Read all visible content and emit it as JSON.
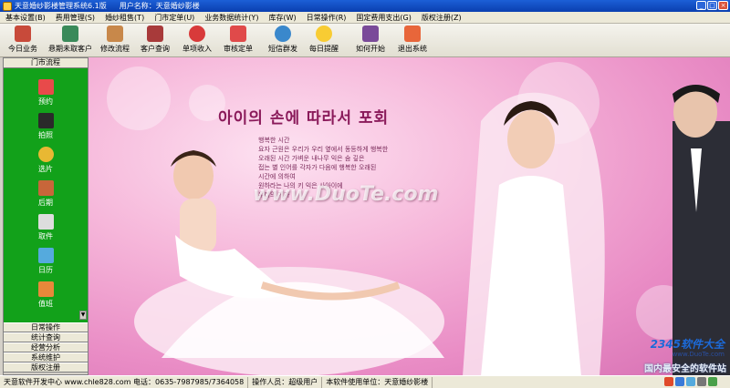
{
  "window": {
    "title": "天意婚纱影楼管理系统6.1版",
    "user_label": "用户名称：天意婚纱影楼",
    "minimize": "_",
    "maximize": "□",
    "close": "×"
  },
  "menu": [
    "基本设置(B)",
    "费用管理(S)",
    "婚纱租售(T)",
    "门市定单(U)",
    "业务数据统计(Y)",
    "库存(W)",
    "日常操作(R)",
    "固定费用支出(G)",
    "版权注册(Z)"
  ],
  "toolbar": [
    {
      "label": "今日业务",
      "icon": "house-icon",
      "color": "#c44"
    },
    {
      "label": "悬期未取客户",
      "icon": "person-icon",
      "color": "#3a6"
    },
    {
      "label": "修改流程",
      "icon": "edit-icon",
      "color": "#c84"
    },
    {
      "label": "客户查询",
      "icon": "bottles-icon",
      "color": "#a33"
    },
    {
      "label": "单项收入",
      "icon": "money-icon",
      "color": "#d33"
    },
    {
      "label": "审核定单",
      "icon": "check-icon",
      "color": "#d44"
    },
    {
      "label": "短信群发",
      "icon": "globe-icon",
      "color": "#38c"
    },
    {
      "label": "每日提醒",
      "icon": "bulb-icon",
      "color": "#fc3"
    },
    {
      "label": "如何开始",
      "icon": "book-icon",
      "color": "#749"
    },
    {
      "label": "退出系统",
      "icon": "exit-icon",
      "color": "#e63"
    }
  ],
  "sidebar": {
    "header": "门市流程",
    "items": [
      {
        "label": "预约",
        "icon": "calendar-icon",
        "color": "#e44"
      },
      {
        "label": "拍照",
        "icon": "camera-icon",
        "color": "#222"
      },
      {
        "label": "选片",
        "icon": "film-icon",
        "color": "#eb3"
      },
      {
        "label": "后期",
        "icon": "palette-icon",
        "color": "#c63"
      },
      {
        "label": "取件",
        "icon": "package-icon",
        "color": "#ddd"
      },
      {
        "label": "日历",
        "icon": "notebook-icon",
        "color": "#5ad"
      },
      {
        "label": "值班",
        "icon": "duty-icon",
        "color": "#e83"
      }
    ],
    "categories": [
      "日常操作",
      "统计查询",
      "经营分析",
      "系统维护",
      "版权注册"
    ]
  },
  "banner": {
    "korean_title": "아이의 손에 따라서 포회",
    "poem": [
      "행복한 시간",
      "요자 근원은 우리가 우리 옆에서 동등하게 행복한",
      "오래된 시간 가벼운 내나무 익은 숨 깊은",
      "접는 별 인어를 각자가 다음에 행복한 오래된",
      "시간에 의하여",
      "원하라는 나의 키 익은 사아이에",
      "우리의 기가"
    ],
    "watermark": "www.DuoTe.com",
    "corner_brand": "2345软件大全",
    "corner_url": "www.DuoTe.com",
    "corner_slogan": "国内最安全的软件站"
  },
  "status": {
    "developer": "天意软件开发中心 www.chle828.com 电话：0635-7987985/7364058",
    "operator": "操作人员：超级用户",
    "unit": "本软件使用单位：天意婚纱影楼"
  }
}
